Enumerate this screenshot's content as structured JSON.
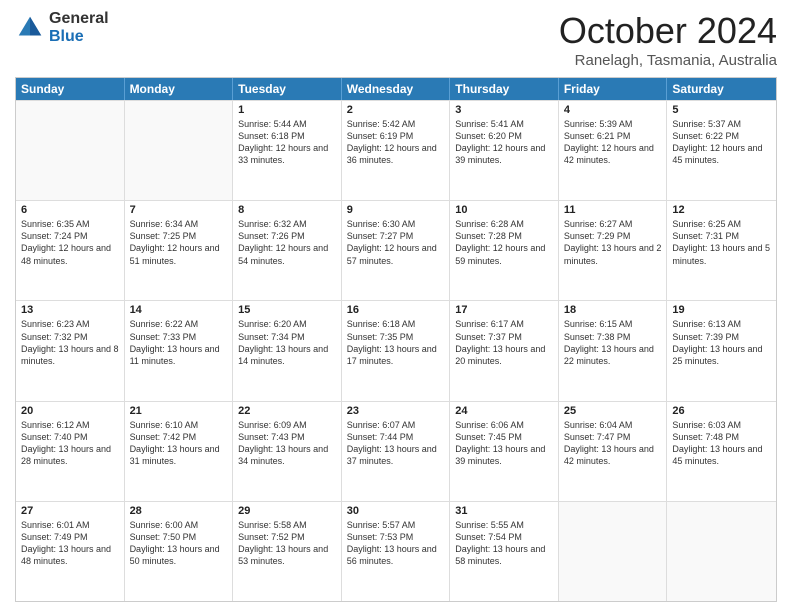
{
  "logo": {
    "general": "General",
    "blue": "Blue"
  },
  "title": "October 2024",
  "subtitle": "Ranelagh, Tasmania, Australia",
  "header_days": [
    "Sunday",
    "Monday",
    "Tuesday",
    "Wednesday",
    "Thursday",
    "Friday",
    "Saturday"
  ],
  "rows": [
    [
      {
        "day": "",
        "sunrise": "",
        "sunset": "",
        "daylight": "",
        "empty": true
      },
      {
        "day": "",
        "sunrise": "",
        "sunset": "",
        "daylight": "",
        "empty": true
      },
      {
        "day": "1",
        "sunrise": "Sunrise: 5:44 AM",
        "sunset": "Sunset: 6:18 PM",
        "daylight": "Daylight: 12 hours and 33 minutes."
      },
      {
        "day": "2",
        "sunrise": "Sunrise: 5:42 AM",
        "sunset": "Sunset: 6:19 PM",
        "daylight": "Daylight: 12 hours and 36 minutes."
      },
      {
        "day": "3",
        "sunrise": "Sunrise: 5:41 AM",
        "sunset": "Sunset: 6:20 PM",
        "daylight": "Daylight: 12 hours and 39 minutes."
      },
      {
        "day": "4",
        "sunrise": "Sunrise: 5:39 AM",
        "sunset": "Sunset: 6:21 PM",
        "daylight": "Daylight: 12 hours and 42 minutes."
      },
      {
        "day": "5",
        "sunrise": "Sunrise: 5:37 AM",
        "sunset": "Sunset: 6:22 PM",
        "daylight": "Daylight: 12 hours and 45 minutes."
      }
    ],
    [
      {
        "day": "6",
        "sunrise": "Sunrise: 6:35 AM",
        "sunset": "Sunset: 7:24 PM",
        "daylight": "Daylight: 12 hours and 48 minutes."
      },
      {
        "day": "7",
        "sunrise": "Sunrise: 6:34 AM",
        "sunset": "Sunset: 7:25 PM",
        "daylight": "Daylight: 12 hours and 51 minutes."
      },
      {
        "day": "8",
        "sunrise": "Sunrise: 6:32 AM",
        "sunset": "Sunset: 7:26 PM",
        "daylight": "Daylight: 12 hours and 54 minutes."
      },
      {
        "day": "9",
        "sunrise": "Sunrise: 6:30 AM",
        "sunset": "Sunset: 7:27 PM",
        "daylight": "Daylight: 12 hours and 57 minutes."
      },
      {
        "day": "10",
        "sunrise": "Sunrise: 6:28 AM",
        "sunset": "Sunset: 7:28 PM",
        "daylight": "Daylight: 12 hours and 59 minutes."
      },
      {
        "day": "11",
        "sunrise": "Sunrise: 6:27 AM",
        "sunset": "Sunset: 7:29 PM",
        "daylight": "Daylight: 13 hours and 2 minutes."
      },
      {
        "day": "12",
        "sunrise": "Sunrise: 6:25 AM",
        "sunset": "Sunset: 7:31 PM",
        "daylight": "Daylight: 13 hours and 5 minutes."
      }
    ],
    [
      {
        "day": "13",
        "sunrise": "Sunrise: 6:23 AM",
        "sunset": "Sunset: 7:32 PM",
        "daylight": "Daylight: 13 hours and 8 minutes."
      },
      {
        "day": "14",
        "sunrise": "Sunrise: 6:22 AM",
        "sunset": "Sunset: 7:33 PM",
        "daylight": "Daylight: 13 hours and 11 minutes."
      },
      {
        "day": "15",
        "sunrise": "Sunrise: 6:20 AM",
        "sunset": "Sunset: 7:34 PM",
        "daylight": "Daylight: 13 hours and 14 minutes."
      },
      {
        "day": "16",
        "sunrise": "Sunrise: 6:18 AM",
        "sunset": "Sunset: 7:35 PM",
        "daylight": "Daylight: 13 hours and 17 minutes."
      },
      {
        "day": "17",
        "sunrise": "Sunrise: 6:17 AM",
        "sunset": "Sunset: 7:37 PM",
        "daylight": "Daylight: 13 hours and 20 minutes."
      },
      {
        "day": "18",
        "sunrise": "Sunrise: 6:15 AM",
        "sunset": "Sunset: 7:38 PM",
        "daylight": "Daylight: 13 hours and 22 minutes."
      },
      {
        "day": "19",
        "sunrise": "Sunrise: 6:13 AM",
        "sunset": "Sunset: 7:39 PM",
        "daylight": "Daylight: 13 hours and 25 minutes."
      }
    ],
    [
      {
        "day": "20",
        "sunrise": "Sunrise: 6:12 AM",
        "sunset": "Sunset: 7:40 PM",
        "daylight": "Daylight: 13 hours and 28 minutes."
      },
      {
        "day": "21",
        "sunrise": "Sunrise: 6:10 AM",
        "sunset": "Sunset: 7:42 PM",
        "daylight": "Daylight: 13 hours and 31 minutes."
      },
      {
        "day": "22",
        "sunrise": "Sunrise: 6:09 AM",
        "sunset": "Sunset: 7:43 PM",
        "daylight": "Daylight: 13 hours and 34 minutes."
      },
      {
        "day": "23",
        "sunrise": "Sunrise: 6:07 AM",
        "sunset": "Sunset: 7:44 PM",
        "daylight": "Daylight: 13 hours and 37 minutes."
      },
      {
        "day": "24",
        "sunrise": "Sunrise: 6:06 AM",
        "sunset": "Sunset: 7:45 PM",
        "daylight": "Daylight: 13 hours and 39 minutes."
      },
      {
        "day": "25",
        "sunrise": "Sunrise: 6:04 AM",
        "sunset": "Sunset: 7:47 PM",
        "daylight": "Daylight: 13 hours and 42 minutes."
      },
      {
        "day": "26",
        "sunrise": "Sunrise: 6:03 AM",
        "sunset": "Sunset: 7:48 PM",
        "daylight": "Daylight: 13 hours and 45 minutes."
      }
    ],
    [
      {
        "day": "27",
        "sunrise": "Sunrise: 6:01 AM",
        "sunset": "Sunset: 7:49 PM",
        "daylight": "Daylight: 13 hours and 48 minutes."
      },
      {
        "day": "28",
        "sunrise": "Sunrise: 6:00 AM",
        "sunset": "Sunset: 7:50 PM",
        "daylight": "Daylight: 13 hours and 50 minutes."
      },
      {
        "day": "29",
        "sunrise": "Sunrise: 5:58 AM",
        "sunset": "Sunset: 7:52 PM",
        "daylight": "Daylight: 13 hours and 53 minutes."
      },
      {
        "day": "30",
        "sunrise": "Sunrise: 5:57 AM",
        "sunset": "Sunset: 7:53 PM",
        "daylight": "Daylight: 13 hours and 56 minutes."
      },
      {
        "day": "31",
        "sunrise": "Sunrise: 5:55 AM",
        "sunset": "Sunset: 7:54 PM",
        "daylight": "Daylight: 13 hours and 58 minutes."
      },
      {
        "day": "",
        "sunrise": "",
        "sunset": "",
        "daylight": "",
        "empty": true
      },
      {
        "day": "",
        "sunrise": "",
        "sunset": "",
        "daylight": "",
        "empty": true
      }
    ]
  ]
}
